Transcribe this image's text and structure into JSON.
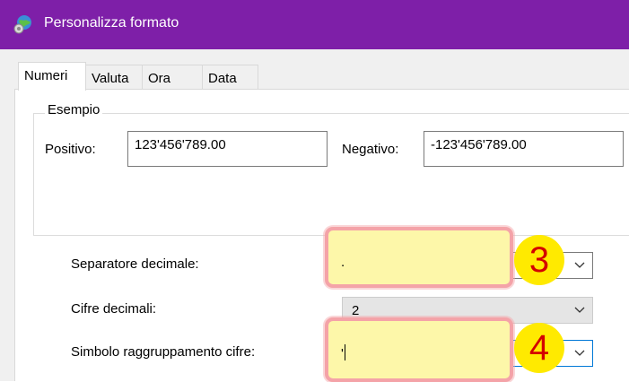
{
  "window": {
    "title": "Personalizza formato",
    "icon": "globe-settings-icon",
    "accent_color": "#7e1fa8"
  },
  "tabs": [
    {
      "label": "Numeri",
      "active": true
    },
    {
      "label": "Valuta",
      "active": false
    },
    {
      "label": "Ora",
      "active": false
    },
    {
      "label": "Data",
      "active": false
    }
  ],
  "example": {
    "legend": "Esempio",
    "positive_label": "Positivo:",
    "positive_value": "123'456'789.00",
    "negative_label": "Negativo:",
    "negative_value": "-123'456'789.00"
  },
  "settings": {
    "decimal_separator_label": "Separatore decimale:",
    "decimal_separator_value": ".",
    "decimal_digits_label": "Cifre decimali:",
    "decimal_digits_value": "2",
    "grouping_symbol_label": "Simbolo raggruppamento cifre:",
    "grouping_symbol_value": "'"
  },
  "annotations": {
    "step_3": "3",
    "step_4": "4",
    "highlight_color": "#fdf7a9",
    "badge_color": "#ffea00",
    "badge_text_color": "#d40000"
  }
}
